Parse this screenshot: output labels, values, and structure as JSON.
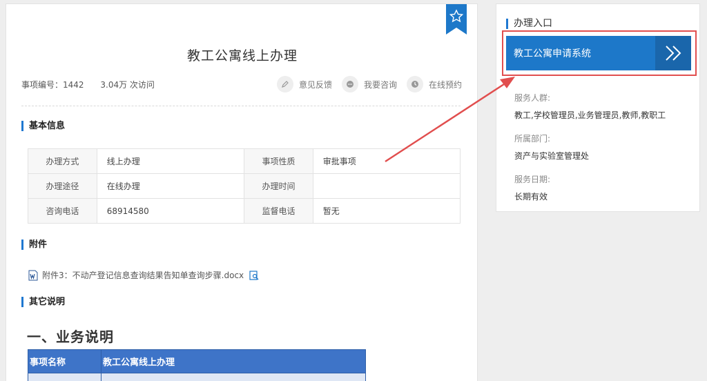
{
  "main": {
    "title": "教工公寓线上办理",
    "item_no": "事项编号：1442",
    "visits": "3.04万 次访问",
    "actions": [
      {
        "label": "意见反馈",
        "icon": "pencil-icon"
      },
      {
        "label": "我要咨询",
        "icon": "chat-icon"
      },
      {
        "label": "在线预约",
        "icon": "clock-icon"
      }
    ],
    "basic_info_heading": "基本信息",
    "info_table": [
      [
        "办理方式",
        "线上办理",
        "事项性质",
        "审批事项"
      ],
      [
        "办理途径",
        "在线办理",
        "办理时间",
        ""
      ],
      [
        "咨询电话",
        "68914580",
        "监督电话",
        "暂无"
      ]
    ],
    "attachments_heading": "附件",
    "attachment": "附件3：不动产登记信息查询结果告知单查询步骤.docx",
    "other_heading": "其它说明",
    "section_title": "一、业务说明",
    "biz_table": {
      "headers": [
        "事项名称",
        "教工公寓线上办理"
      ]
    }
  },
  "side": {
    "heading": "办理入口",
    "entry_button": "教工公寓申请系统",
    "audience_label": "服务人群:",
    "audience": "教工,学校管理员,业务管理员,教师,教职工",
    "dept_label": "所属部门:",
    "dept": "资产与实验室管理处",
    "date_label": "服务日期:",
    "date": "长期有效"
  },
  "colors": {
    "accent": "#1d78c9",
    "highlight": "#e14e4e",
    "table_header": "#3e74c8"
  }
}
